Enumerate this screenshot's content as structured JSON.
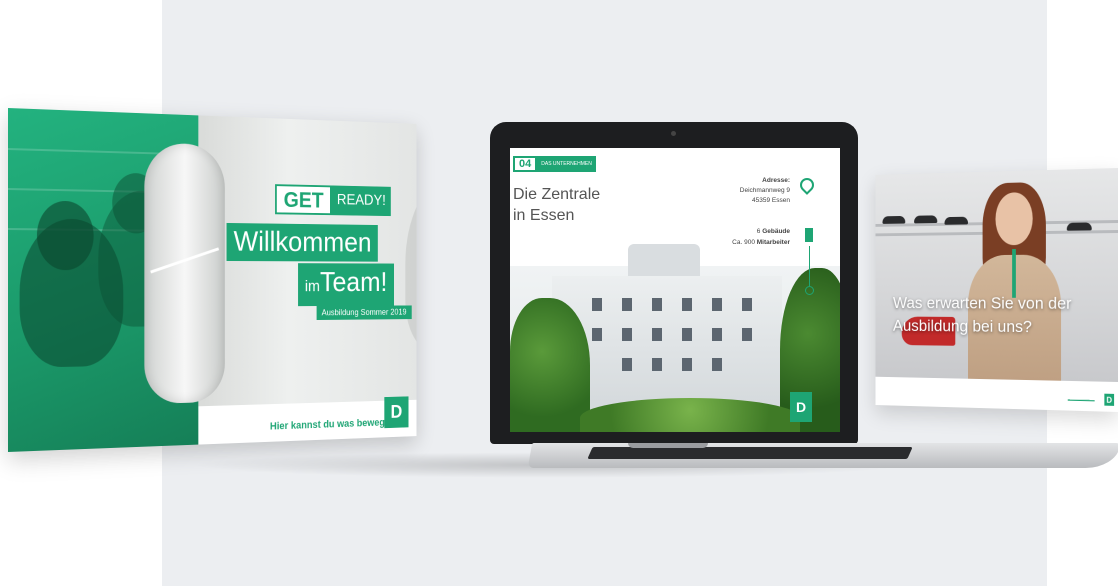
{
  "left_slide": {
    "get": "GET",
    "ready": "READY!",
    "title_line1": "Willkommen",
    "title_line2_small": "im",
    "title_line2_big": "Team!",
    "subtitle": "Ausbildung Sommer 2019",
    "tagline": "Hier kannst du was bewegen.",
    "logo_letter": "D"
  },
  "laptop_slide": {
    "section_number": "04",
    "section_label": "DAS UNTERNEHMEN",
    "title_line1": "Die Zentrale",
    "title_line2": "in Essen",
    "address_label": "Adresse:",
    "address_street": "Deichmannweg 9",
    "address_city": "45359 Essen",
    "buildings_value": "6",
    "buildings_label": "Gebäude",
    "employees_prefix": "Ca. 900",
    "employees_label": "Mitarbeiter",
    "logo_letter": "D"
  },
  "right_slide": {
    "question_line1": "Was erwarten Sie von der",
    "question_line2": "Ausbildung bei uns?",
    "logo_letter": "D"
  },
  "colors": {
    "brand_green": "#1ea574",
    "backdrop": "#eceef1"
  }
}
